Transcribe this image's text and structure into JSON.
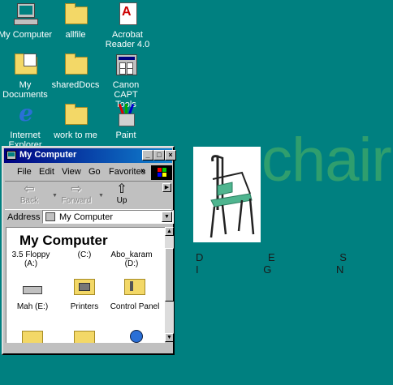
{
  "desktop": {
    "icons": [
      {
        "label": "My Computer",
        "icon": "my-computer-icon"
      },
      {
        "label": "allfile",
        "icon": "folder-icon"
      },
      {
        "label": "Acrobat Reader 4.0",
        "icon": "acrobat-icon"
      },
      {
        "label": "My Documents",
        "icon": "my-documents-icon"
      },
      {
        "label": "sharedDocs",
        "icon": "folder-icon"
      },
      {
        "label": "Canon CAPT Tools",
        "icon": "canon-capt-icon"
      },
      {
        "label": "Internet Explorer",
        "icon": "internet-explorer-icon"
      },
      {
        "label": "work to me",
        "icon": "folder-icon"
      },
      {
        "label": "Paint",
        "icon": "paint-icon"
      }
    ]
  },
  "wallpaper": {
    "chair_text": "chair",
    "design_text": "D E S I G N"
  },
  "window": {
    "title": "My Computer",
    "menu": [
      "File",
      "Edit",
      "View",
      "Go",
      "Favorites"
    ],
    "menu_overflow": "»",
    "toolbar": {
      "back": "Back",
      "forward": "Forward",
      "up": "Up"
    },
    "address": {
      "label": "Address",
      "value": "My Computer"
    },
    "content": {
      "heading": "My Computer",
      "items": [
        {
          "label": "3.5 Floppy (A:)",
          "icon": "floppy-drive-icon"
        },
        {
          "label": "(C:)",
          "icon": "hard-drive-icon"
        },
        {
          "label": "Abo_karam (D:)",
          "icon": "hard-drive-icon"
        },
        {
          "label": "Mah (E:)",
          "icon": "drive-icon"
        },
        {
          "label": "Printers",
          "icon": "printers-folder-icon"
        },
        {
          "label": "Control Panel",
          "icon": "control-panel-icon"
        }
      ]
    }
  }
}
